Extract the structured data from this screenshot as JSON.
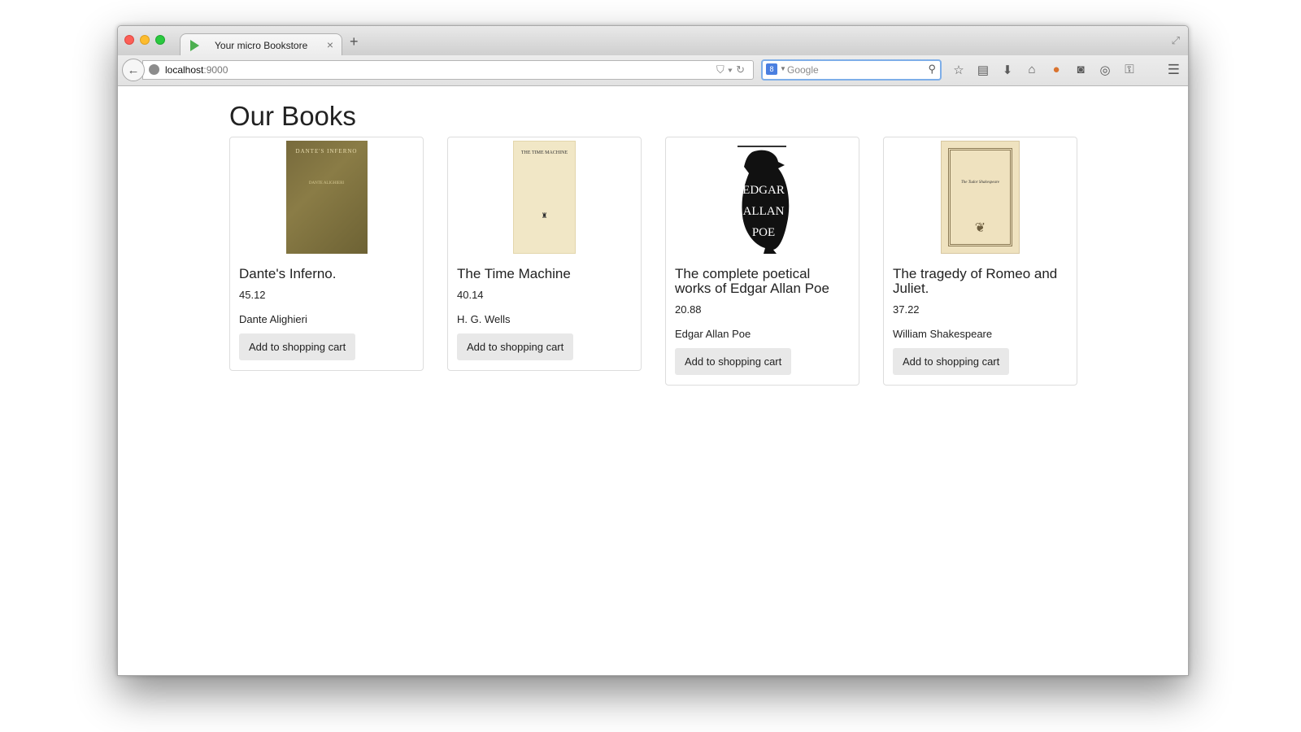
{
  "browser": {
    "tab_title": "Your micro Bookstore",
    "url_host": "localhost",
    "url_port": ":9000",
    "search_placeholder": "Google"
  },
  "page": {
    "title": "Our Books"
  },
  "books": [
    {
      "title": "Dante's Inferno.",
      "price": "45.12",
      "author": "Dante Alighieri",
      "button_label": "Add to shopping cart",
      "cover_text": "DANTE'S INFERNO"
    },
    {
      "title": "The Time Machine",
      "price": "40.14",
      "author": "H. G. Wells",
      "button_label": "Add to shopping cart",
      "cover_text": "THE TIME MACHINE"
    },
    {
      "title": "The complete poetical works of Edgar Allan Poe",
      "price": "20.88",
      "author": "Edgar Allan Poe",
      "button_label": "Add to shopping cart",
      "cover_text": "EDGAR ALLAN POE"
    },
    {
      "title": "The tragedy of Romeo and Juliet.",
      "price": "37.22",
      "author": "William Shakespeare",
      "button_label": "Add to shopping cart",
      "cover_text": "The Tudor Shakespeare"
    }
  ],
  "icons": {
    "tab": "play-icon",
    "toolbar": [
      "star-icon",
      "reading-list-icon",
      "download-icon",
      "home-icon",
      "firefox-account-icon",
      "pocket-icon",
      "shield-icon",
      "key-icon",
      "menu-icon"
    ]
  },
  "colors": {
    "accent_play": "#4caf50",
    "search_focus": "#7eaee8"
  }
}
